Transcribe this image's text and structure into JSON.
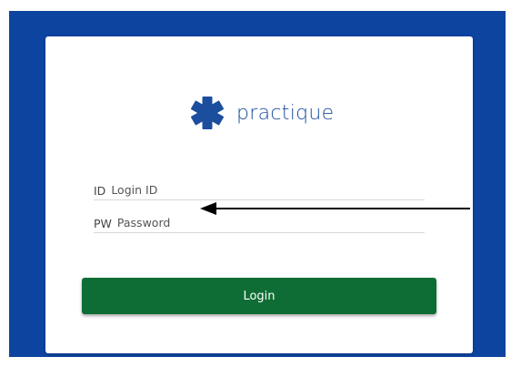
{
  "brand": {
    "name": "practique",
    "icon": "star-of-life-icon",
    "icon_color": "#1b4e9c"
  },
  "form": {
    "id_label": "ID",
    "id_placeholder": "Login ID",
    "pw_label": "PW",
    "pw_placeholder": "Password",
    "login_label": "Login"
  },
  "colors": {
    "background": "#0d44a0",
    "card": "#ffffff",
    "login_button": "#0e6d34",
    "annotation_arrow": "#000000"
  }
}
